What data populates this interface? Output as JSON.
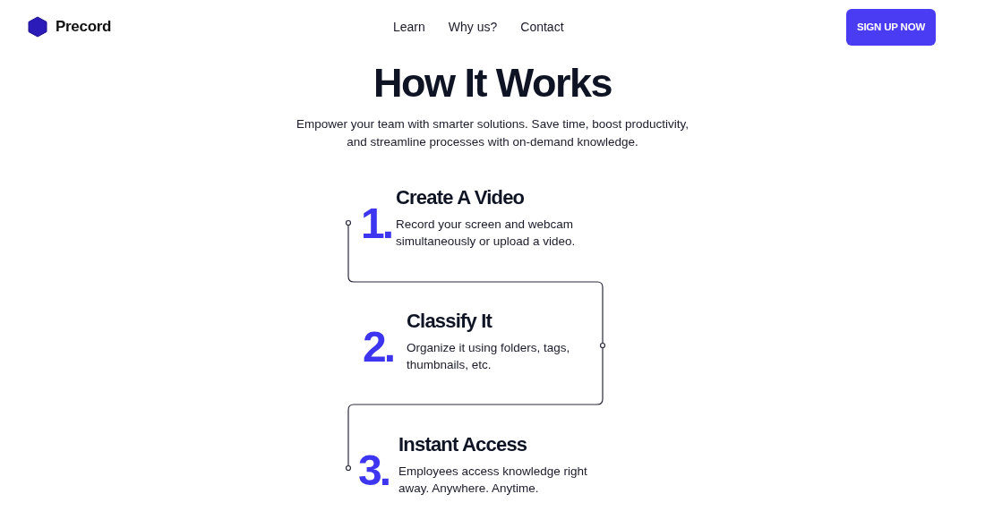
{
  "brand": {
    "name": "Precord"
  },
  "nav": {
    "links": [
      "Learn",
      "Why us?",
      "Contact"
    ],
    "cta": "SIGN UP NOW"
  },
  "hero": {
    "title": "How It Works",
    "subtitle": "Empower your team with smarter solutions. Save time, boost productivity, and streamline processes with on-demand knowledge."
  },
  "steps": [
    {
      "number": "1.",
      "title": "Create A Video",
      "description": "Record your screen and webcam simultaneously or upload a video."
    },
    {
      "number": "2.",
      "title": "Classify It",
      "description": "Organize it using folders, tags, thumbnails, etc."
    },
    {
      "number": "3.",
      "title": "Instant Access",
      "description": "Employees access knowledge right away. Anywhere. Anytime."
    }
  ]
}
